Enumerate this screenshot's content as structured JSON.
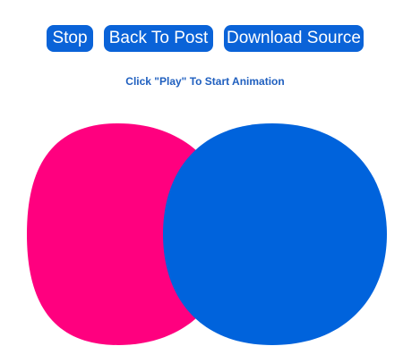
{
  "toolbar": {
    "stop_label": "Stop",
    "back_label": "Back To Post",
    "download_label": "Download Source"
  },
  "hint": {
    "text": "Click \"Play\" To Start Animation"
  },
  "colors": {
    "button_bg": "#0a63d8",
    "hint_text": "#1f5fbf",
    "pink_circle": "#ff007f",
    "blue_circle": "#0063dc"
  }
}
